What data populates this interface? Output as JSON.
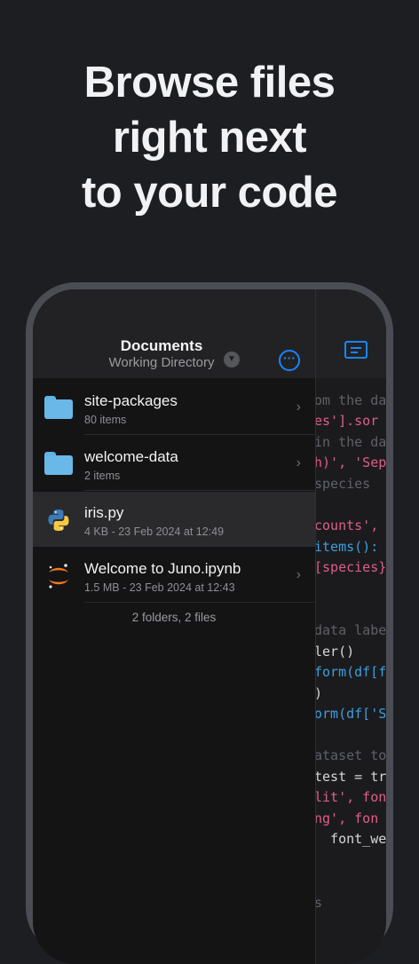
{
  "headline": {
    "lines": [
      "Browse files",
      "right next",
      "to your code"
    ]
  },
  "files_header": {
    "title": "Documents",
    "subtitle": "Working Directory"
  },
  "files": [
    {
      "name": "site-packages",
      "meta": "80 items",
      "icon": "folder-icon"
    },
    {
      "name": "welcome-data",
      "meta": "2 items",
      "icon": "folder-icon"
    },
    {
      "name": "iris.py",
      "meta": "4 KB - 23 Feb 2024 at 12:49",
      "icon": "python-icon"
    },
    {
      "name": "Welcome to Juno.ipynb",
      "meta": "1.5 MB - 23 Feb 2024 at 12:43",
      "icon": "jupyter-icon"
    }
  ],
  "summary": "2 folders, 2 files",
  "code_lines": [
    "om the da",
    "es'].sor",
    "in the da",
    "h)', 'Sep",
    "species",
    "",
    "counts',",
    "items():",
    "[species}",
    "",
    "",
    "data labe",
    "ler()",
    "form(df[f",
    ")",
    "orm(df['S",
    "",
    "ataset to",
    "test = tr",
    "lit', fon",
    "ng', fon",
    "  font_we",
    "",
    "",
    "s"
  ],
  "colors": {
    "accent": "#1a84ff",
    "folder": "#6ab8e8"
  }
}
